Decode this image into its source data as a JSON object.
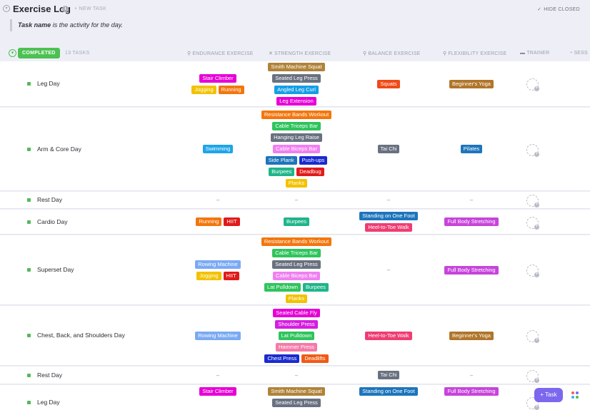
{
  "header": {
    "title": "Exercise Log",
    "new_task": "+ NEW TASK",
    "hide_closed": "HIDE CLOSED",
    "note_bold": "Task name",
    "note_rest": " is the activity for the day."
  },
  "group": {
    "status": "COMPLETED",
    "count": "13 TASKS",
    "columns": [
      "ENDURANCE EXERCISE",
      "STRENGTH EXERCISE",
      "BALANCE EXERCISE",
      "FLEXIBILITY EXERCISE",
      "TRAINER",
      "SESS"
    ]
  },
  "colors": {
    "Stair Climber": "#e600d6",
    "Jogging": "#f2c200",
    "Running": "#f3760d",
    "Swimming": "#1ea4e8",
    "HIIT": "#e01b1b",
    "Rowing Machine": "#7baaf4",
    "Smith Machine Squat": "#b0833a",
    "Seated Leg Press": "#697180",
    "Angled Leg Curl": "#159ee6",
    "Leg Extension": "#e600d6",
    "Resistance Bands Workout": "#f3760d",
    "Cable Triceps Bar": "#2fc45c",
    "Hanging Leg Raise": "#697180",
    "Cable Biceps Bar": "#ef80f0",
    "Side Plank": "#1d75bc",
    "Push-ups": "#1a2bcf",
    "Burpees": "#1fb58a",
    "Deadbug": "#e01b1b",
    "Planks": "#f2c200",
    "Lat Pulldown": "#2fc45c",
    "Seated Cable Fly": "#e600d6",
    "Shoulder Press": "#d51ee0",
    "Hammer Press": "#f47aa8",
    "Chest Press": "#1a2bcf",
    "Deadlifts": "#ef5a16",
    "Squats": "#ef4a16",
    "Tai Chi": "#697180",
    "Standing on One Foot": "#1d75bc",
    "Heel-to-Toe Walk": "#ee3d73",
    "Beginner's Yoga": "#b0762a",
    "Pilates": "#1d75bc",
    "Full Body Stretching": "#c744db"
  },
  "rows": [
    {
      "name": "Leg Day",
      "endurance": [
        [
          "Stair Climber"
        ],
        [
          "Jogging",
          "Running"
        ]
      ],
      "strength": [
        [
          "Smith Machine Squat"
        ],
        [
          "Seated Leg Press"
        ],
        [
          "Angled Leg Curl"
        ],
        [
          "Leg Extension"
        ]
      ],
      "balance": [
        [
          "Squats"
        ]
      ],
      "flexibility": [
        [
          "Beginner's Yoga"
        ]
      ]
    },
    {
      "name": "Arm & Core Day",
      "endurance": [
        [
          "Swimming"
        ]
      ],
      "strength": [
        [
          "Resistance Bands Workout"
        ],
        [
          "Cable Triceps Bar"
        ],
        [
          "Hanging Leg Raise"
        ],
        [
          "Cable Biceps Bar"
        ],
        [
          "Side Plank",
          "Push-ups"
        ],
        [
          "Burpees",
          "Deadbug"
        ],
        [
          "Planks"
        ]
      ],
      "balance": [
        [
          "Tai Chi"
        ]
      ],
      "flexibility": [
        [
          "Pilates"
        ]
      ]
    },
    {
      "name": "Rest Day",
      "endurance": "–",
      "strength": "–",
      "balance": "–",
      "flexibility": "–"
    },
    {
      "name": "Cardio Day",
      "endurance": [
        [
          "Running",
          "HIIT"
        ]
      ],
      "strength": [
        [
          "Burpees"
        ]
      ],
      "balance": [
        [
          "Standing on One Foot"
        ],
        [
          "Heel-to-Toe Walk"
        ]
      ],
      "flexibility": [
        [
          "Full Body Stretching"
        ]
      ]
    },
    {
      "name": "Superset Day",
      "endurance": [
        [
          "Rowing Machine"
        ],
        [
          "Jogging",
          "HIIT"
        ]
      ],
      "strength": [
        [
          "Resistance Bands Workout"
        ],
        [
          "Cable Triceps Bar"
        ],
        [
          "Seated Leg Press"
        ],
        [
          "Cable Biceps Bar"
        ],
        [
          "Lat Pulldown",
          "Burpees"
        ],
        [
          "Planks"
        ]
      ],
      "balance": "–",
      "flexibility": [
        [
          "Full Body Stretching"
        ]
      ]
    },
    {
      "name": "Chest, Back, and Shoulders Day",
      "endurance": [
        [
          "Rowing Machine"
        ]
      ],
      "strength": [
        [
          "Seated Cable Fly"
        ],
        [
          "Shoulder Press"
        ],
        [
          "Lat Pulldown"
        ],
        [
          "Hammer Press"
        ],
        [
          "Chest Press",
          "Deadlifts"
        ]
      ],
      "balance": [
        [
          "Heel-to-Toe Walk"
        ]
      ],
      "flexibility": [
        [
          "Beginner's Yoga"
        ]
      ]
    },
    {
      "name": "Rest Day",
      "endurance": "–",
      "strength": "–",
      "balance": [
        [
          "Tai Chi"
        ]
      ],
      "flexibility": "–"
    },
    {
      "name": "Leg Day",
      "endurance": [
        [
          "Stair Climber"
        ]
      ],
      "strength": [
        [
          "Smith Machine Squat"
        ],
        [
          "Seated Leg Press"
        ]
      ],
      "balance": [
        [
          "Standing on One Foot"
        ]
      ],
      "flexibility": [
        [
          "Full Body Stretching"
        ]
      ]
    }
  ],
  "fab": {
    "task": "+ Task"
  }
}
